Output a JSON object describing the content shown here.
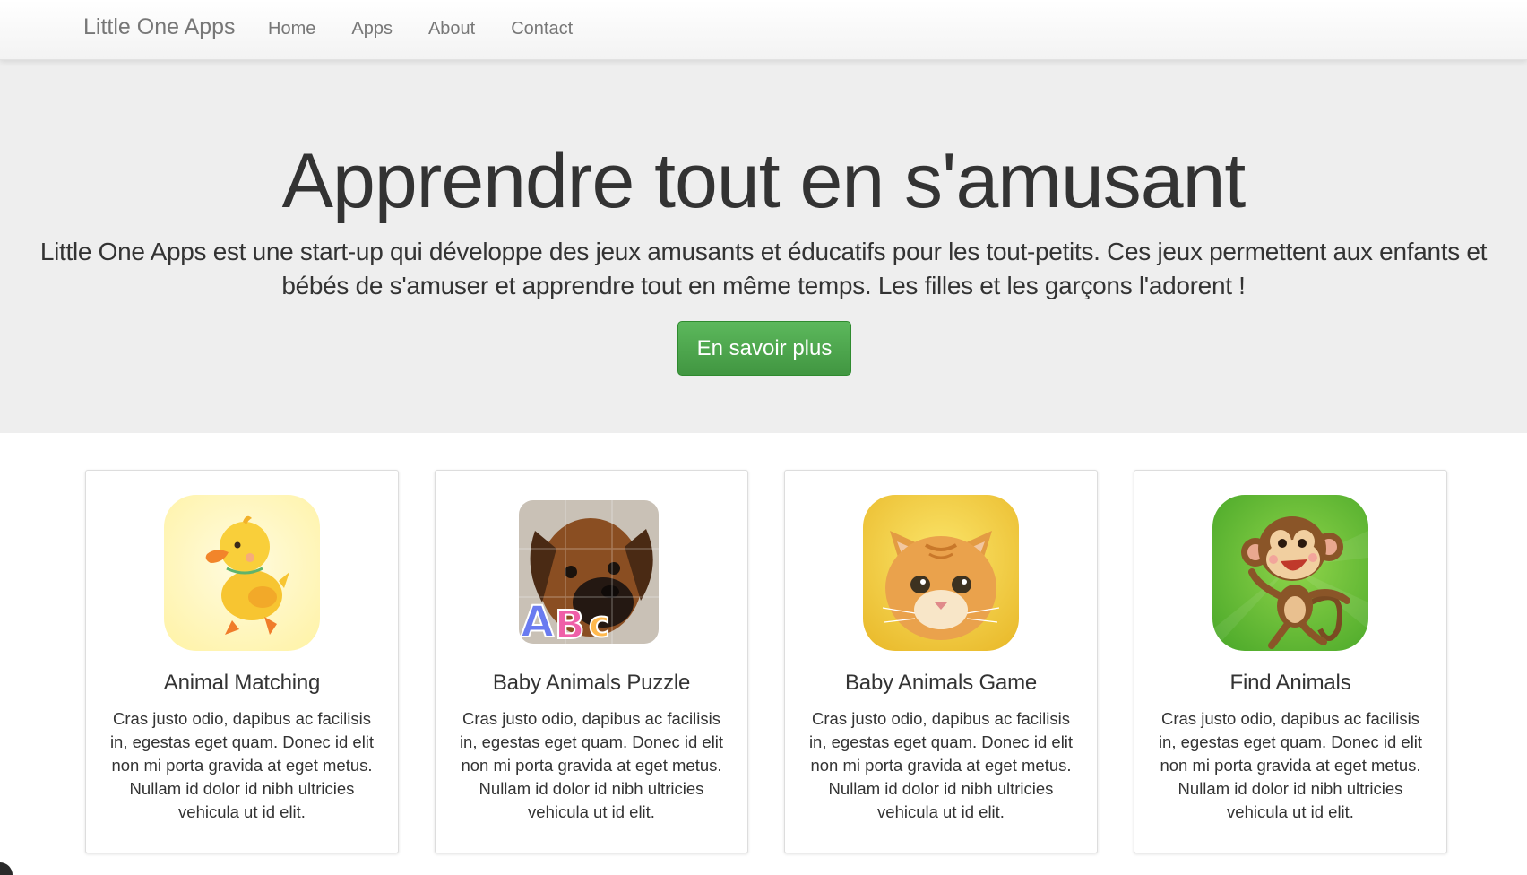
{
  "navbar": {
    "brand": "Little One Apps",
    "links": [
      "Home",
      "Apps",
      "About",
      "Contact"
    ]
  },
  "hero": {
    "title": "Apprendre tout en s'amusant",
    "text": "Little One Apps est une start-up qui développe des jeux amusants et éducatifs pour les tout-petits. Ces jeux permettent aux enfants et bébés de s'amuser et apprendre tout en même temps. Les filles et les garçons l'adorent !",
    "button": "En savoir plus",
    "button_color": "#5cb85c"
  },
  "apps": [
    {
      "title": "Animal Matching",
      "icon": "duck-icon",
      "text": "Cras justo odio, dapibus ac facilisis in, egestas eget quam. Donec id elit non mi porta gravida at eget metus. Nullam id dolor id nibh ultricies vehicula ut id elit."
    },
    {
      "title": "Baby Animals Puzzle",
      "icon": "puppy-abc-icon",
      "text": "Cras justo odio, dapibus ac facilisis in, egestas eget quam. Donec id elit non mi porta gravida at eget metus. Nullam id dolor id nibh ultricies vehicula ut id elit."
    },
    {
      "title": "Baby Animals Game",
      "icon": "kitten-icon",
      "text": "Cras justo odio, dapibus ac facilisis in, egestas eget quam. Donec id elit non mi porta gravida at eget metus. Nullam id dolor id nibh ultricies vehicula ut id elit."
    },
    {
      "title": "Find Animals",
      "icon": "monkey-icon",
      "text": "Cras justo odio, dapibus ac facilisis in, egestas eget quam. Donec id elit non mi porta gravida at eget metus. Nullam id dolor id nibh ultricies vehicula ut id elit."
    }
  ]
}
